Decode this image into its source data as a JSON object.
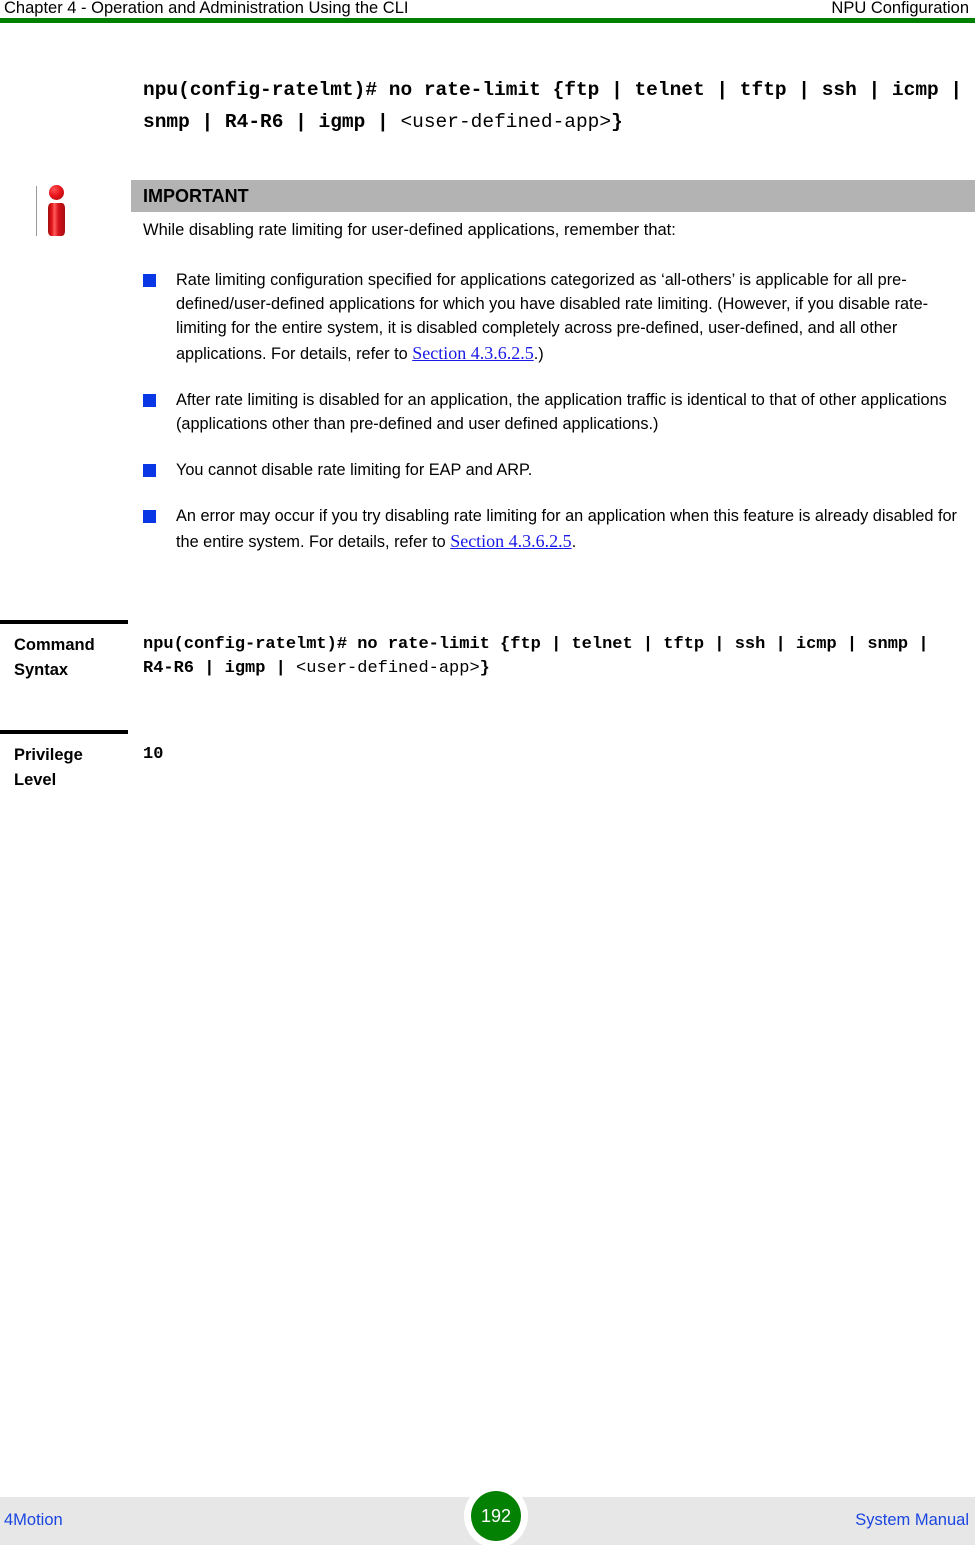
{
  "header": {
    "left": "Chapter 4 - Operation and Administration Using the CLI",
    "right": "NPU Configuration",
    "rule_color": "#008000"
  },
  "command_top": {
    "bold_part": "npu(config-ratelmt)# no rate-limit {ftp | telnet | tftp | ssh | icmp | snmp | R4-R6 | igmp | ",
    "plain_part": "<user-defined-app>",
    "tail": "}"
  },
  "note": {
    "icon": "info-icon",
    "title": "IMPORTANT",
    "title_bar_color": "#b3b3b3",
    "intro": "While disabling rate limiting for user-defined applications, remember that:",
    "bullet_color": "#0a37e6",
    "link_color": "#1a1ae6",
    "bullets": [
      {
        "text_before": "Rate limiting configuration specified for applications categorized as ‘all-others’ is applicable for all pre-defined/user-defined applications for which you have disabled rate limiting. (However, if you disable rate-limiting for the entire system, it is disabled completely across pre-defined, user-defined, and all other applications. For details, refer to ",
        "link": "Section 4.3.6.2.5",
        "text_after": ".)"
      },
      {
        "text_before": "After rate limiting is disabled for an application, the application traffic is identical to that of other applications (applications other than pre-defined and user defined applications.)",
        "link": "",
        "text_after": ""
      },
      {
        "text_before": "You cannot disable rate limiting for EAP and ARP.",
        "link": "",
        "text_after": ""
      },
      {
        "text_before": "An error may occur if you try disabling rate limiting for an application when this feature is already disabled for the entire system. For details, refer to ",
        "link": "Section 4.3.6.2.5",
        "text_after": "."
      }
    ]
  },
  "param_table": {
    "rows": [
      {
        "label": "Command Syntax",
        "value_bold": "npu(config-ratelmt)# no rate-limit {ftp | telnet | tftp | ssh | icmp | snmp | R4-R6 | igmp | ",
        "value_plain": "<user-defined-app>",
        "value_tail": "}"
      },
      {
        "label": "Privilege Level",
        "value_bold": "10",
        "value_plain": "",
        "value_tail": ""
      }
    ]
  },
  "footer": {
    "left": "4Motion",
    "page_number": "192",
    "right": "System Manual",
    "badge_color": "#038103",
    "band_color": "#e7e7e7",
    "link_color": "#1a46e0"
  }
}
